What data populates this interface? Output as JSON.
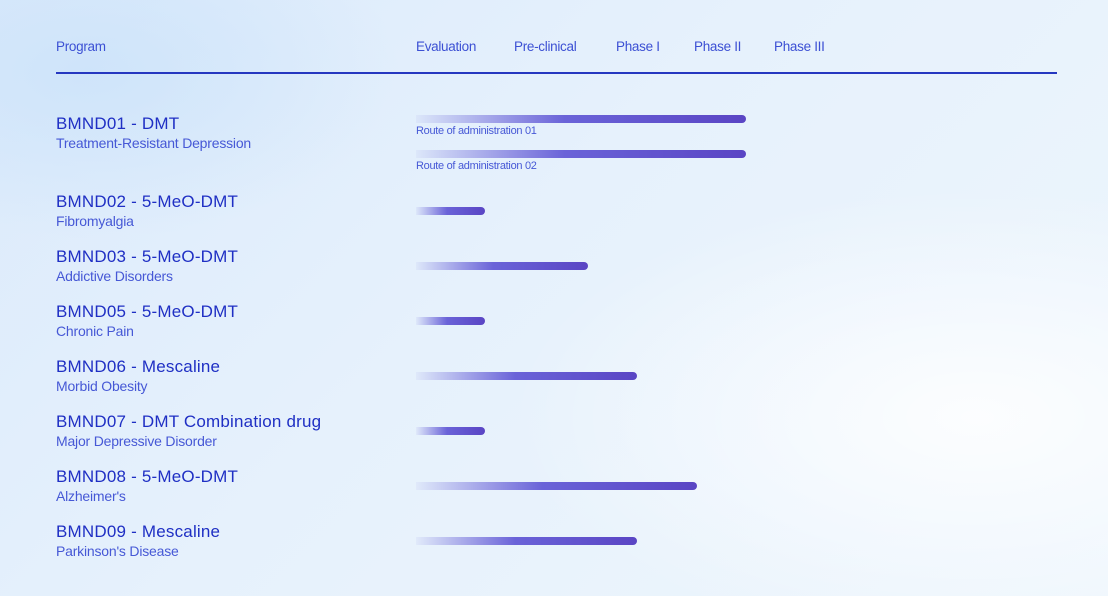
{
  "header": {
    "program": "Program",
    "evaluation": "Evaluation",
    "preclinical": "Pre-clinical",
    "phase1": "Phase I",
    "phase2": "Phase II",
    "phase3": "Phase III"
  },
  "programs": [
    {
      "title": "BMND01 - DMT",
      "indication": "Treatment-Resistant Depression",
      "routes": [
        {
          "label": "Route of administration 01",
          "progress": 1.0
        },
        {
          "label": "Route of administration 02",
          "progress": 1.0
        }
      ],
      "progress_note": "fraction of pipeline width up to Phase II"
    },
    {
      "title": "BMND02 - 5-MeO-DMT",
      "indication": "Fibromyalgia",
      "progress": 0.21
    },
    {
      "title": "BMND03 - 5-MeO-DMT",
      "indication": "Addictive Disorders",
      "progress": 0.52
    },
    {
      "title": "BMND05 - 5-MeO-DMT",
      "indication": "Chronic Pain",
      "progress": 0.21
    },
    {
      "title": "BMND06 - Mescaline",
      "indication": "Morbid Obesity",
      "progress": 0.67
    },
    {
      "title": "BMND07 - DMT Combination drug",
      "indication": "Major Depressive Disorder",
      "progress": 0.21
    },
    {
      "title": "BMND08 - 5-MeO-DMT",
      "indication": "Alzheimer's",
      "progress": 0.85
    },
    {
      "title": "BMND09 - Mescaline",
      "indication": "Parkinson's Disease",
      "progress": 0.67
    }
  ],
  "colors": {
    "accent": "#1f2fc4",
    "bar_end": "#5a45c4",
    "divider": "#2537c0"
  }
}
